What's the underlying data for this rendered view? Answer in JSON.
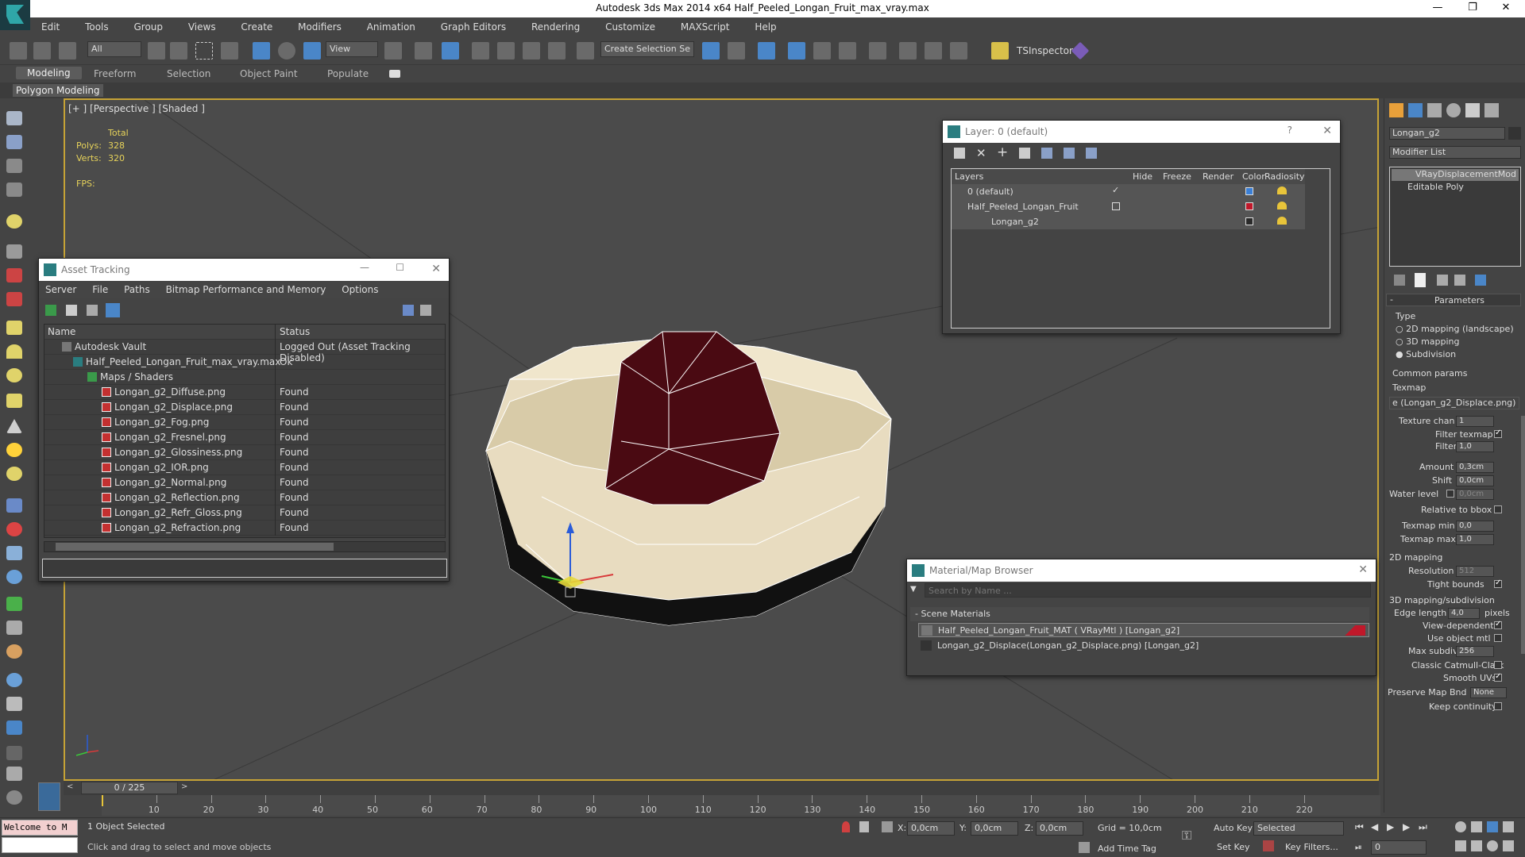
{
  "window": {
    "title": "Autodesk 3ds Max  2014 x64     Half_Peeled_Longan_Fruit_max_vray.max"
  },
  "menu": [
    "Edit",
    "Tools",
    "Group",
    "Views",
    "Create",
    "Modifiers",
    "Animation",
    "Graph Editors",
    "Rendering",
    "Customize",
    "MAXScript",
    "Help"
  ],
  "toolbar": {
    "selection_filter": "All",
    "ref_coord": "View",
    "selection_set_placeholder": "Create Selection Se",
    "tsinspector": "TSInspector"
  },
  "ribbon": {
    "tabs": [
      "Modeling",
      "Freeform",
      "Selection",
      "Object Paint",
      "Populate"
    ],
    "sub": "Polygon Modeling"
  },
  "viewport": {
    "label": "[+ ] [Perspective ] [Shaded ]",
    "stats_total": "Total",
    "polys_label": "Polys:",
    "polys": "328",
    "verts_label": "Verts:",
    "verts": "320",
    "fps_label": "FPS:"
  },
  "asset_tracking": {
    "title": "Asset Tracking",
    "menu": [
      "Server",
      "File",
      "Paths",
      "Bitmap Performance and Memory",
      "Options"
    ],
    "col_name": "Name",
    "col_status": "Status",
    "rows": [
      {
        "name": "Autodesk Vault",
        "status": "Logged Out (Asset Tracking Disabled)"
      },
      {
        "name": "Half_Peeled_Longan_Fruit_max_vray.max",
        "status": "Ok"
      },
      {
        "name": "Maps / Shaders",
        "status": ""
      },
      {
        "name": "Longan_g2_Diffuse.png",
        "status": "Found"
      },
      {
        "name": "Longan_g2_Displace.png",
        "status": "Found"
      },
      {
        "name": "Longan_g2_Fog.png",
        "status": "Found"
      },
      {
        "name": "Longan_g2_Fresnel.png",
        "status": "Found"
      },
      {
        "name": "Longan_g2_Glossiness.png",
        "status": "Found"
      },
      {
        "name": "Longan_g2_IOR.png",
        "status": "Found"
      },
      {
        "name": "Longan_g2_Normal.png",
        "status": "Found"
      },
      {
        "name": "Longan_g2_Reflection.png",
        "status": "Found"
      },
      {
        "name": "Longan_g2_Refr_Gloss.png",
        "status": "Found"
      },
      {
        "name": "Longan_g2_Refraction.png",
        "status": "Found"
      }
    ]
  },
  "layer_window": {
    "title": "Layer: 0 (default)",
    "help": "?",
    "cols": [
      "Layers",
      "Hide",
      "Freeze",
      "Render",
      "Color",
      "Radiosity"
    ],
    "rows": [
      {
        "name": "0 (default)",
        "color": "#3a7fd6"
      },
      {
        "name": "Half_Peeled_Longan_Fruit",
        "color": "#c0182a"
      },
      {
        "name": "Longan_g2",
        "color": "#2a2a2a"
      }
    ]
  },
  "material_browser": {
    "title": "Material/Map Browser",
    "search_placeholder": "Search by Name ...",
    "section": "- Scene Materials",
    "items": [
      "Half_Peeled_Longan_Fruit_MAT  ( VRayMtl )  [Longan_g2]",
      "Longan_g2_Displace(Longan_g2_Displace.png) [Longan_g2]"
    ]
  },
  "right_panel": {
    "object_name": "Longan_g2",
    "modifier_list": "Modifier List",
    "stack": [
      "VRayDisplacementMod",
      "Editable Poly"
    ],
    "rollout": "Parameters",
    "type_label": "Type",
    "type_options": [
      "2D mapping (landscape)",
      "3D mapping",
      "Subdivision"
    ],
    "common_params": "Common params",
    "texmap_label": "Texmap",
    "texmap_value": "e (Longan_g2_Displace.png)",
    "texture_chan_label": "Texture chan",
    "texture_chan": "1",
    "filter_texmap": "Filter texmap",
    "filter_blur_label": "Filter blur",
    "filter_blur": "1,0",
    "amount_label": "Amount",
    "amount": "0,3cm",
    "shift_label": "Shift",
    "shift": "0,0cm",
    "water_level_label": "Water level",
    "water_level": "0,0cm",
    "relative_bbox": "Relative to bbox",
    "texmap_min_label": "Texmap min",
    "texmap_min": "0,0",
    "texmap_max_label": "Texmap max",
    "texmap_max": "1,0",
    "mapping2d": "2D mapping",
    "resolution_label": "Resolution",
    "resolution": "512",
    "tight_bounds": "Tight bounds",
    "mapping3d": "3D mapping/subdivision",
    "edge_length_label": "Edge length",
    "edge_length": "4,0",
    "pixels": "pixels",
    "view_dependent": "View-dependent",
    "use_object_mtl": "Use object mtl",
    "max_subdivs_label": "Max subdivs",
    "max_subdivs": "256",
    "classic_catmull": "Classic Catmull-Clark",
    "smooth_uvs": "Smooth UVs",
    "preserve_map_label": "Preserve Map Bnd",
    "preserve_map": "None",
    "keep_continuity": "Keep continuity"
  },
  "timeline": {
    "frame": "0 / 225",
    "ticks": [
      "10",
      "20",
      "30",
      "40",
      "50",
      "60",
      "70",
      "80",
      "90",
      "100",
      "110",
      "120",
      "130",
      "140",
      "150",
      "160",
      "170",
      "180",
      "190",
      "200",
      "210",
      "220"
    ]
  },
  "status": {
    "maxscript": "Welcome to M",
    "selected": "1 Object Selected",
    "prompt": "Click and drag to select and move objects",
    "x_label": "X:",
    "x": "0,0cm",
    "y_label": "Y:",
    "y": "0,0cm",
    "z_label": "Z:",
    "z": "0,0cm",
    "grid": "Grid = 10,0cm",
    "add_time_tag": "Add Time Tag",
    "auto_key": "Auto Key",
    "set_key": "Set Key",
    "selected_dropdown": "Selected",
    "key_filters": "Key Filters...",
    "frame_field": "0"
  }
}
